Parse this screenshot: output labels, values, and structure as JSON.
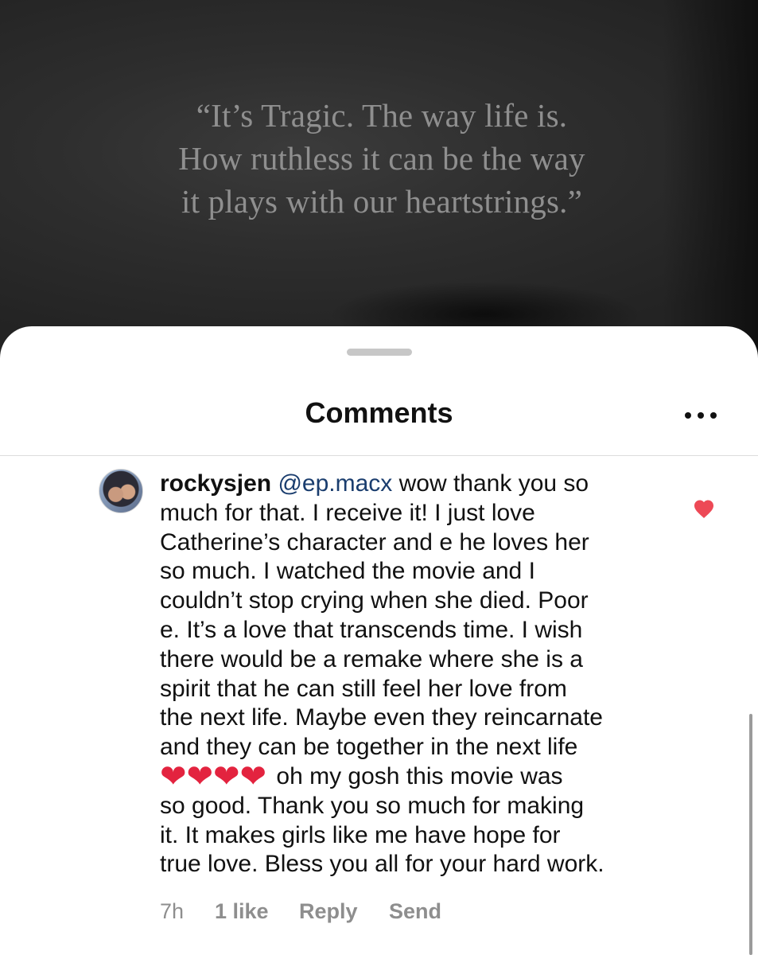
{
  "background": {
    "quote_lines": [
      "“It’s Tragic. The way life is.",
      "How ruthless it can be the way",
      "it plays with our heartstrings.”"
    ]
  },
  "sheet": {
    "title": "Comments",
    "more_icon": "more-horizontal-icon"
  },
  "comment": {
    "username": "rockysjen",
    "mention": "@ep.macx",
    "lines": [
      " wow thank you so",
      "much for that. I receive it! I just love",
      "Catherine’s character and e he loves her",
      "so much. I watched the movie and I",
      "couldn’t stop crying when she died. Poor",
      "e. It’s a love that transcends time. I wish",
      "there would be a remake where she is a",
      "spirit that he can still feel her love from",
      "the next life. Maybe even they reincarnate",
      "and they can be together in the next life"
    ],
    "emoji_line_text": " oh my gosh this movie was",
    "emoji": "❤❤❤❤",
    "lines_after": [
      "so good. Thank you so much for making",
      "it. It makes girls like me have hope for",
      "true love. Bless you all for your hard work."
    ],
    "liked": true,
    "like_color": "#ED4956",
    "time": "7h",
    "likes": "1 like",
    "reply_label": "Reply",
    "send_label": "Send"
  }
}
